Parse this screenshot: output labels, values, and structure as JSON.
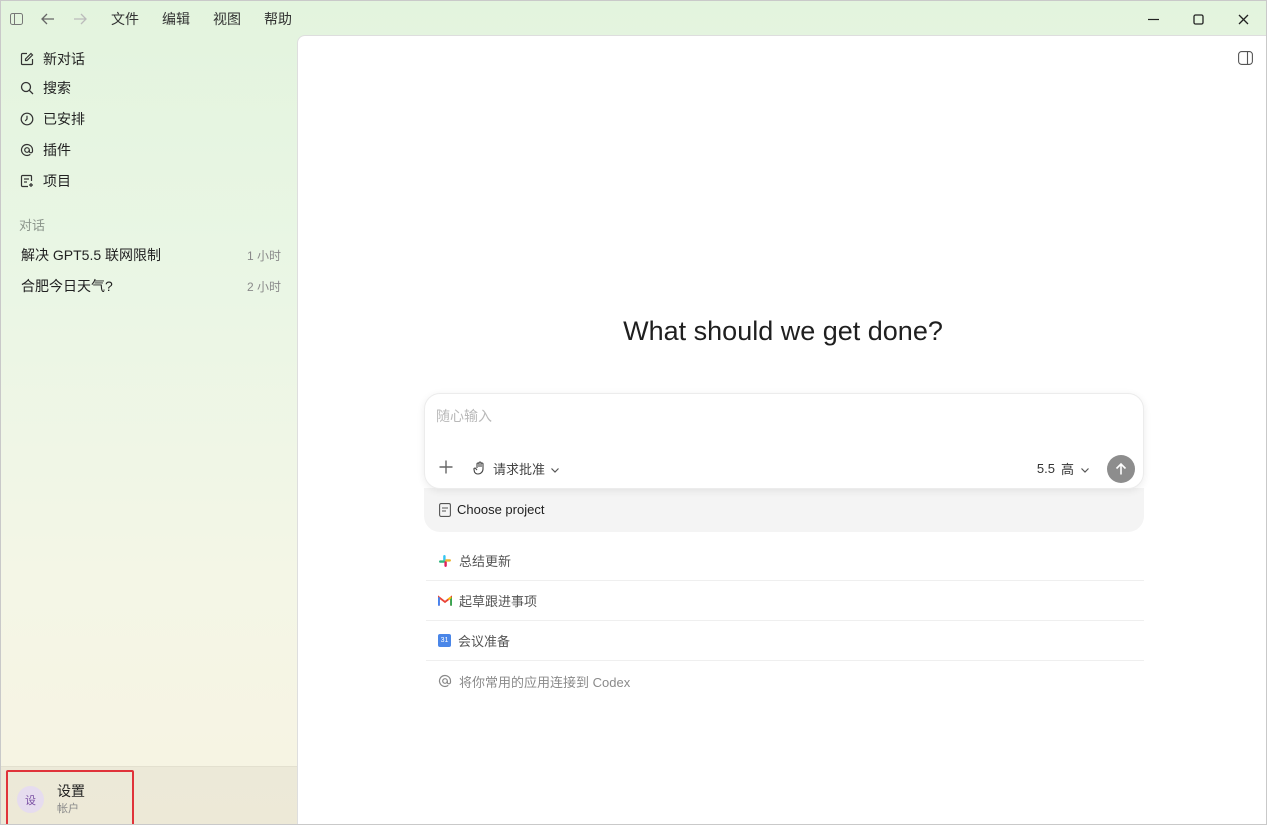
{
  "menu": {
    "file": "文件",
    "edit": "编辑",
    "view": "视图",
    "help": "帮助"
  },
  "sidebar": {
    "nav": [
      {
        "label": "新对话",
        "icon": "edit-icon"
      },
      {
        "label": "搜索",
        "icon": "search-icon"
      },
      {
        "label": "已安排",
        "icon": "clock-icon"
      },
      {
        "label": "插件",
        "icon": "at-icon"
      },
      {
        "label": "项目",
        "icon": "project-icon"
      }
    ],
    "section_label": "对话",
    "conversations": [
      {
        "title": "解决 GPT5.5 联网限制",
        "time": "1 小时"
      },
      {
        "title": "合肥今日天气?",
        "time": "2 小时"
      }
    ],
    "account": {
      "avatar_text": "设",
      "name": "设置",
      "subtitle": "帐户"
    }
  },
  "main": {
    "heading": "What should we get done?",
    "composer": {
      "placeholder": "随心输入",
      "approval_label": "请求批准",
      "model_version": "5.5",
      "model_effort": "高"
    },
    "project_label": "Choose project",
    "suggestions": [
      {
        "label": "总结更新",
        "icon": "slack-icon"
      },
      {
        "label": "起草跟进事项",
        "icon": "gmail-icon"
      },
      {
        "label": "会议准备",
        "icon": "calendar-icon",
        "icon_text": "31"
      },
      {
        "label": "将你常用的应用连接到 Codex",
        "icon": "at-icon"
      }
    ]
  },
  "colors": {
    "highlight": "#e0333a",
    "send_button": "#8d8d8d"
  }
}
